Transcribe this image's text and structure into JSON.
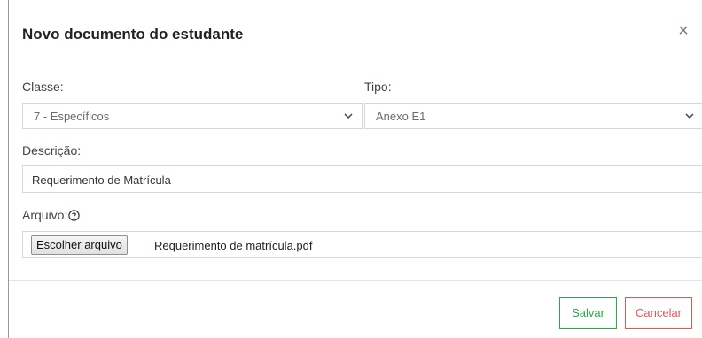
{
  "dialog": {
    "title": "Novo documento do estudante",
    "close_symbol": "×"
  },
  "form": {
    "classe": {
      "label": "Classe:",
      "value": "7 - Específicos"
    },
    "tipo": {
      "label": "Tipo:",
      "value": "Anexo E1"
    },
    "descricao": {
      "label": "Descrição:",
      "value": "Requerimento de Matrícula"
    },
    "arquivo": {
      "label": "Arquivo:",
      "button_label": "Escolher arquivo",
      "file_name": "Requerimento de matrícula.pdf"
    }
  },
  "footer": {
    "save_label": "Salvar",
    "cancel_label": "Cancelar"
  },
  "colors": {
    "save": "#2aa84a",
    "cancel": "#e15858",
    "border": "#d6d6d6"
  },
  "icons": {
    "close": "close-icon",
    "help": "help-circle-icon",
    "dropdown": "chevron-down-icon"
  }
}
